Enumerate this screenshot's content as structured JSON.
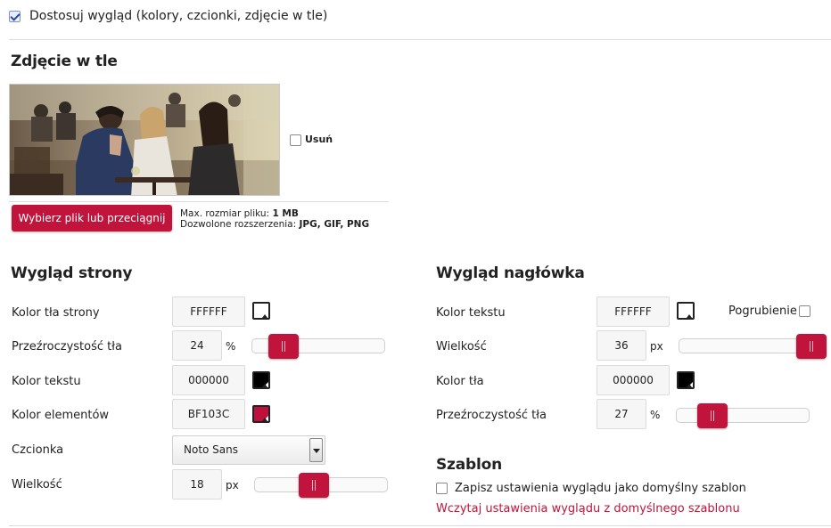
{
  "customize": {
    "label": "Dostosuj wygląd (kolory, czcionki, zdjęcie w tle)",
    "checked": true
  },
  "background": {
    "title": "Zdjęcie w tle",
    "remove_label": "Usuń",
    "remove_checked": false,
    "choose_button": "Wybierz plik lub przeciągnij",
    "max_size_label": "Max. rozmiar pliku:",
    "max_size_value": "1 MB",
    "ext_label": "Dozwolone rozszerzenia:",
    "ext_value": "JPG, GIF, PNG"
  },
  "page_look": {
    "title": "Wygląd strony",
    "bg_color": {
      "label": "Kolor tła strony",
      "value": "FFFFFF",
      "swatch": "#FFFFFF"
    },
    "bg_opacity": {
      "label": "Przeźroczystość tła",
      "value": "24",
      "unit": "%",
      "slider_fraction": 0.18
    },
    "text_color": {
      "label": "Kolor tekstu",
      "value": "000000",
      "swatch": "#000000"
    },
    "element_color": {
      "label": "Kolor elementów",
      "value": "BF103C",
      "swatch": "#BF103C"
    },
    "font": {
      "label": "Czcionka",
      "value": "Noto Sans"
    },
    "size": {
      "label": "Wielkość",
      "value": "18",
      "unit": "px",
      "slider_fraction": 0.43
    }
  },
  "header_look": {
    "title": "Wygląd nagłówka",
    "text_color": {
      "label": "Kolor tekstu",
      "value": "FFFFFF",
      "swatch": "#FFFFFF"
    },
    "bold": {
      "label": "Pogrubienie",
      "checked": false
    },
    "size": {
      "label": "Wielkość",
      "value": "36",
      "unit": "px",
      "slider_fraction": 1.0
    },
    "bg_color": {
      "label": "Kolor tła",
      "value": "000000",
      "swatch": "#000000"
    },
    "bg_opacity": {
      "label": "Przeźroczystość tła",
      "value": "27",
      "unit": "%",
      "slider_fraction": 0.2
    }
  },
  "template": {
    "title": "Szablon",
    "save_label": "Zapisz ustawienia wyglądu jako domyślny szablon",
    "save_checked": false,
    "load_link": "Wczytaj ustawienia wyglądu z domyślnego szablonu"
  },
  "colors": {
    "accent": "#C0143C"
  }
}
